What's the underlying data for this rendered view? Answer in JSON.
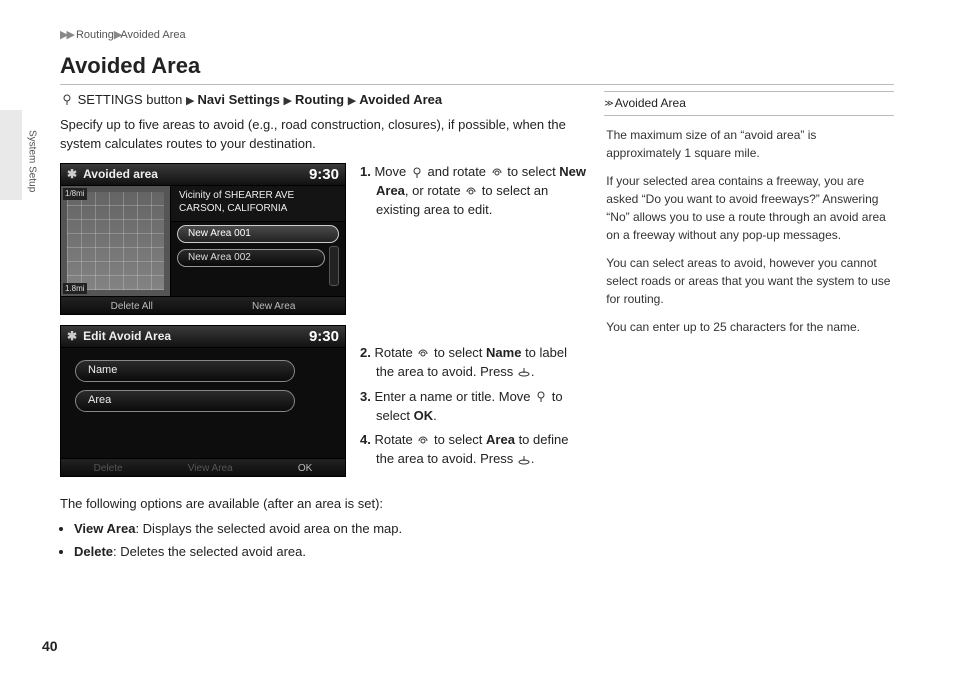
{
  "breadcrumb": {
    "level1": "Routing",
    "level2": "Avoided Area"
  },
  "page_title": "Avoided Area",
  "side_tab_label": "System Setup",
  "nav_path": {
    "prefix": "SETTINGS button",
    "s1": "Navi Settings",
    "s2": "Routing",
    "s3": "Avoided Area"
  },
  "intro": "Specify up to five areas to avoid (e.g., road construction, closures), if possible, when the system calculates routes to your destination.",
  "screen1": {
    "title": "Avoided area",
    "clock": "9:30",
    "vicinity_l1": "Vicinity of SHEARER AVE",
    "vicinity_l2": "CARSON, CALIFORNIA",
    "scale_top": "1/8mi",
    "scale_bot": "1.8mi",
    "items": [
      "New Area 001",
      "New Area 002"
    ],
    "footer_left": "Delete All",
    "footer_right": "New Area"
  },
  "screen2": {
    "title": "Edit Avoid Area",
    "clock": "9:30",
    "row1": "Name",
    "row2": "Area",
    "footer_left": "Delete",
    "footer_mid": "View Area",
    "footer_right": "OK"
  },
  "steps": {
    "s1a": "Move ",
    "s1b": " and rotate ",
    "s1c": " to select ",
    "s1_bold": "New Area",
    "s1d": ", or rotate ",
    "s1e": " to select an existing area to edit.",
    "s2a": "Rotate ",
    "s2b": " to select ",
    "s2_bold": "Name",
    "s2c": " to label the area to avoid. Press ",
    "s2d": ".",
    "s3a": "Enter a name or title. Move ",
    "s3b": " to select ",
    "s3_bold": "OK",
    "s3c": ".",
    "s4a": "Rotate ",
    "s4b": " to select ",
    "s4_bold": "Area",
    "s4c": " to define the area to avoid. Press ",
    "s4d": "."
  },
  "after_text": "The following options are available (after an area is set):",
  "bullets": {
    "b1_bold": "View Area",
    "b1_rest": ": Displays the selected avoid area on the map.",
    "b2_bold": "Delete",
    "b2_rest": ": Deletes the selected avoid area."
  },
  "sidebar": {
    "heading": "Avoided Area",
    "p1": "The maximum size of an “avoid area” is approximately 1 square mile.",
    "p2": "If your selected area contains a freeway, you are asked “Do you want to avoid freeways?” Answering “No” allows you to use a route through an avoid area on a freeway without any pop-up messages.",
    "p3": "You can select areas to avoid, however you cannot select roads or areas that you want the system to use for routing.",
    "p4": "You can enter up to 25 characters for the name."
  },
  "page_number": "40"
}
